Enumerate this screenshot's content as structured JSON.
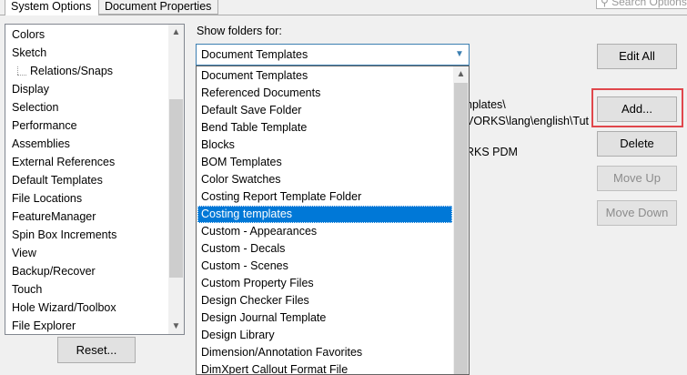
{
  "tabs": [
    {
      "label": "System Options",
      "active": true
    },
    {
      "label": "Document Properties",
      "active": false
    }
  ],
  "search": {
    "placeholder": "Search Options"
  },
  "left_list": {
    "items": [
      {
        "label": "Colors"
      },
      {
        "label": "Sketch"
      },
      {
        "label": "Relations/Snaps",
        "child": true
      },
      {
        "label": "Display"
      },
      {
        "label": "Selection"
      },
      {
        "label": "Performance"
      },
      {
        "label": "Assemblies"
      },
      {
        "label": "External References"
      },
      {
        "label": "Default Templates"
      },
      {
        "label": "File Locations"
      },
      {
        "label": "FeatureManager"
      },
      {
        "label": "Spin Box Increments"
      },
      {
        "label": "View"
      },
      {
        "label": "Backup/Recover"
      },
      {
        "label": "Touch"
      },
      {
        "label": "Hole Wizard/Toolbox"
      },
      {
        "label": "File Explorer"
      }
    ]
  },
  "reset_button": "Reset...",
  "show_folders_label": "Show folders for:",
  "combo_value": "Document Templates",
  "background_folders": [
    "nplates\\",
    "VORKS\\lang\\english\\Tut",
    "RKS PDM"
  ],
  "dropdown": {
    "selected_index": 8,
    "items": [
      "Document Templates",
      "Referenced Documents",
      "Default Save Folder",
      "Bend Table Template",
      "Blocks",
      "BOM Templates",
      "Color Swatches",
      "Costing Report Template Folder",
      "Costing templates",
      "Custom - Appearances",
      "Custom - Decals",
      "Custom - Scenes",
      "Custom Property Files",
      "Design Checker Files",
      "Design Journal Template",
      "Design Library",
      "Dimension/Annotation Favorites",
      "DimXpert Callout Format File"
    ]
  },
  "buttons": {
    "edit_all": "Edit All",
    "add": "Add...",
    "delete": "Delete",
    "move_up": "Move Up",
    "move_down": "Move Down"
  },
  "colors": {
    "selection": "#0078d7",
    "highlight_box": "#e0474c"
  }
}
